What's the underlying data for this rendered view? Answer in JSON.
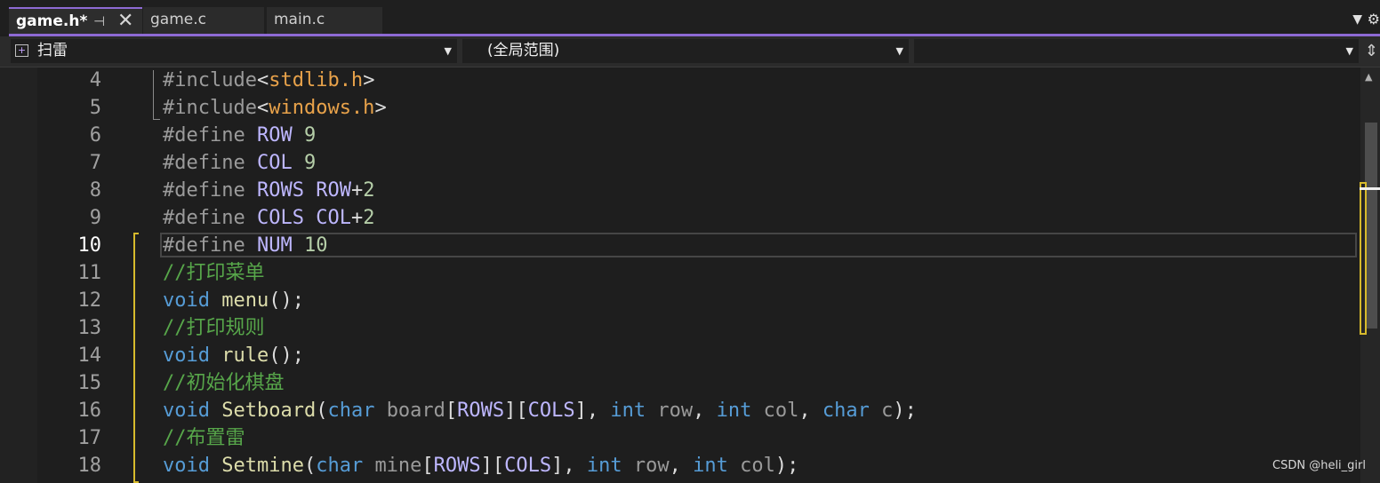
{
  "tabs": [
    {
      "label": "game.h*",
      "active": true
    },
    {
      "label": "game.c",
      "active": false
    },
    {
      "label": "main.c",
      "active": false
    }
  ],
  "nav": {
    "file_scope": "扫雷",
    "scope": "(全局范围)",
    "member": ""
  },
  "editor": {
    "current_line": 10,
    "lines": [
      {
        "num": "4",
        "tokens": [
          [
            "pp",
            "#include"
          ],
          [
            "pu",
            "<"
          ],
          [
            "str",
            "stdlib.h"
          ],
          [
            "pu",
            ">"
          ]
        ]
      },
      {
        "num": "5",
        "tokens": [
          [
            "pp",
            "#include"
          ],
          [
            "pu",
            "<"
          ],
          [
            "str",
            "windows.h"
          ],
          [
            "pu",
            ">"
          ]
        ]
      },
      {
        "num": "6",
        "tokens": [
          [
            "pp",
            "#define"
          ],
          [
            "pu",
            " "
          ],
          [
            "mac",
            "ROW"
          ],
          [
            "pu",
            " "
          ],
          [
            "num-lit",
            "9"
          ]
        ]
      },
      {
        "num": "7",
        "tokens": [
          [
            "pp",
            "#define"
          ],
          [
            "pu",
            " "
          ],
          [
            "mac",
            "COL"
          ],
          [
            "pu",
            " "
          ],
          [
            "num-lit",
            "9"
          ]
        ]
      },
      {
        "num": "8",
        "tokens": [
          [
            "pp",
            "#define"
          ],
          [
            "pu",
            " "
          ],
          [
            "mac",
            "ROWS"
          ],
          [
            "pu",
            " "
          ],
          [
            "mac",
            "ROW"
          ],
          [
            "pu",
            "+"
          ],
          [
            "num-lit",
            "2"
          ]
        ]
      },
      {
        "num": "9",
        "tokens": [
          [
            "pp",
            "#define"
          ],
          [
            "pu",
            " "
          ],
          [
            "mac",
            "COLS"
          ],
          [
            "pu",
            " "
          ],
          [
            "mac",
            "COL"
          ],
          [
            "pu",
            "+"
          ],
          [
            "num-lit",
            "2"
          ]
        ]
      },
      {
        "num": "10",
        "tokens": [
          [
            "pp",
            "#define"
          ],
          [
            "pu",
            " "
          ],
          [
            "mac",
            "NUM"
          ],
          [
            "pu",
            " "
          ],
          [
            "num-lit",
            "10"
          ]
        ]
      },
      {
        "num": "11",
        "tokens": [
          [
            "cm",
            "//打印菜单"
          ]
        ]
      },
      {
        "num": "12",
        "tokens": [
          [
            "kw",
            "void"
          ],
          [
            "pu",
            " "
          ],
          [
            "fn",
            "menu"
          ],
          [
            "pu",
            "();"
          ]
        ]
      },
      {
        "num": "13",
        "tokens": [
          [
            "cm",
            "//打印规则"
          ]
        ]
      },
      {
        "num": "14",
        "tokens": [
          [
            "kw",
            "void"
          ],
          [
            "pu",
            " "
          ],
          [
            "fn",
            "rule"
          ],
          [
            "pu",
            "();"
          ]
        ]
      },
      {
        "num": "15",
        "tokens": [
          [
            "cm",
            "//初始化棋盘"
          ]
        ]
      },
      {
        "num": "16",
        "tokens": [
          [
            "kw",
            "void"
          ],
          [
            "pu",
            " "
          ],
          [
            "fn",
            "Setboard"
          ],
          [
            "pu",
            "("
          ],
          [
            "kw",
            "char"
          ],
          [
            "pu",
            " "
          ],
          [
            "pm",
            "board"
          ],
          [
            "pu",
            "["
          ],
          [
            "mac",
            "ROWS"
          ],
          [
            "pu",
            "]["
          ],
          [
            "mac",
            "COLS"
          ],
          [
            "pu",
            "], "
          ],
          [
            "kw",
            "int"
          ],
          [
            "pu",
            " "
          ],
          [
            "pm",
            "row"
          ],
          [
            "pu",
            ", "
          ],
          [
            "kw",
            "int"
          ],
          [
            "pu",
            " "
          ],
          [
            "pm",
            "col"
          ],
          [
            "pu",
            ", "
          ],
          [
            "kw",
            "char"
          ],
          [
            "pu",
            " "
          ],
          [
            "pm",
            "c"
          ],
          [
            "pu",
            ");"
          ]
        ]
      },
      {
        "num": "17",
        "tokens": [
          [
            "cm",
            "//布置雷"
          ]
        ]
      },
      {
        "num": "18",
        "tokens": [
          [
            "kw",
            "void"
          ],
          [
            "pu",
            " "
          ],
          [
            "fn",
            "Setmine"
          ],
          [
            "pu",
            "("
          ],
          [
            "kw",
            "char"
          ],
          [
            "pu",
            " "
          ],
          [
            "pm",
            "mine"
          ],
          [
            "pu",
            "["
          ],
          [
            "mac",
            "ROWS"
          ],
          [
            "pu",
            "]["
          ],
          [
            "mac",
            "COLS"
          ],
          [
            "pu",
            "], "
          ],
          [
            "kw",
            "int"
          ],
          [
            "pu",
            " "
          ],
          [
            "pm",
            "row"
          ],
          [
            "pu",
            ", "
          ],
          [
            "kw",
            "int"
          ],
          [
            "pu",
            " "
          ],
          [
            "pm",
            "col"
          ],
          [
            "pu",
            ");"
          ]
        ]
      }
    ]
  },
  "watermark": "CSDN @heli_girl",
  "colors": {
    "accent": "#8e6ad4",
    "change_marker": "#d7ba2c",
    "keyword": "#569cd6",
    "macro": "#beb7ff",
    "comment": "#57a64a",
    "string": "#e8a24a",
    "function": "#dcdcaa"
  },
  "icons": [
    "pin-icon",
    "close-icon",
    "dropdown-arrow-icon",
    "gear-icon",
    "project-icon",
    "split-view-icon",
    "scroll-up-icon"
  ]
}
